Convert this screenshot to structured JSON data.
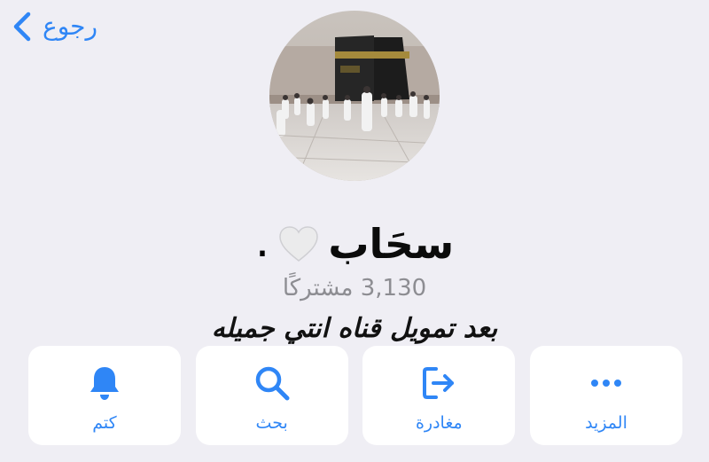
{
  "nav": {
    "back_label": "رجوع"
  },
  "channel": {
    "name": "سحَاب",
    "dot": ".",
    "subscribers": "3,130 مشتركًا",
    "description": "بعد تمويل قناه انتي جميله"
  },
  "actions": [
    {
      "label": "كتم",
      "icon": "bell-icon"
    },
    {
      "label": "بحث",
      "icon": "search-icon"
    },
    {
      "label": "مغادرة",
      "icon": "leave-icon"
    },
    {
      "label": "المزيد",
      "icon": "more-icon"
    }
  ],
  "colors": {
    "accent": "#2f86f6",
    "background": "#efeef4",
    "card": "#ffffff",
    "secondary_text": "#8d8d92"
  }
}
